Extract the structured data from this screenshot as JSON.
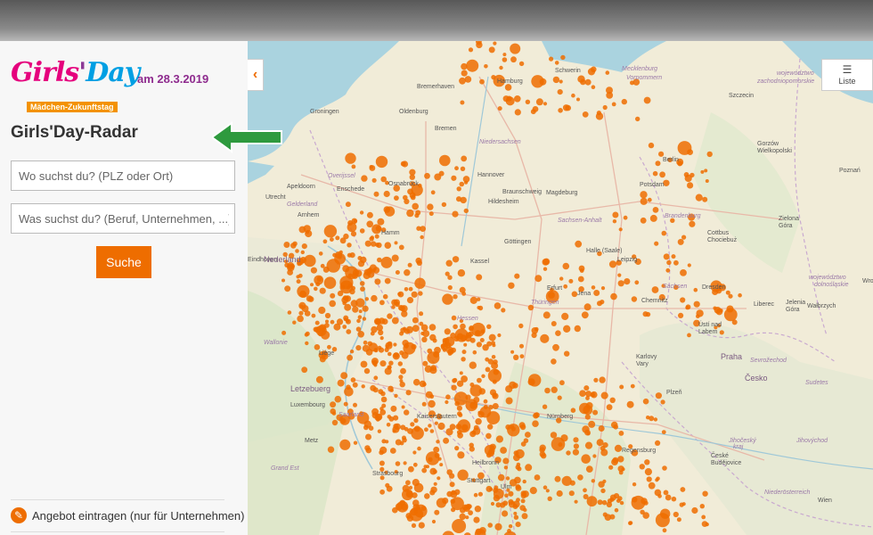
{
  "logo": {
    "part1": "Girls",
    "part2": "'",
    "part3": "Day",
    "banner": "Mädchen-Zukunftstag"
  },
  "date_label": "am 28.3.2019",
  "page_title": "Girls'Day-Radar",
  "search": {
    "where_placeholder": "Wo suchst du? (PLZ oder Ort)",
    "what_placeholder": "Was suchst du? (Beruf, Unternehmen, ...)",
    "button_label": "Suche"
  },
  "footer": {
    "offer_label": "Angebot eintragen (nur für Unternehmen)"
  },
  "map": {
    "collapse_icon": "‹",
    "list_label": "Liste",
    "list_icon": "☰",
    "marker_color": "#ee6d00",
    "labels": [
      {
        "t": "Hamburg"
      },
      {
        "t": "Schwerin"
      },
      {
        "t": "Mecklenburg"
      },
      {
        "t": "Vorpommern"
      },
      {
        "t": "województwo"
      },
      {
        "t": "zachodniopomorskie"
      },
      {
        "t": "Szczecin"
      },
      {
        "t": "Bremerhaven"
      },
      {
        "t": "Groningen"
      },
      {
        "t": "Oldenburg"
      },
      {
        "t": "Bremen"
      },
      {
        "t": "Niedersachsen"
      },
      {
        "t": "Hannover"
      },
      {
        "t": "Braunschweig"
      },
      {
        "t": "Magdeburg"
      },
      {
        "t": "Berlin"
      },
      {
        "t": "Potsdam"
      },
      {
        "t": "Brandenburg"
      },
      {
        "t": "Gorzów"
      },
      {
        "t": "Wielkopolski"
      },
      {
        "t": "Poznań"
      },
      {
        "t": "Zielona"
      },
      {
        "t": "Góra"
      },
      {
        "t": "Osnabrück"
      },
      {
        "t": "Enschede"
      },
      {
        "t": "Apeldoorn"
      },
      {
        "t": "Arnhem"
      },
      {
        "t": "Gelderland"
      },
      {
        "t": "Utrecht"
      },
      {
        "t": "Overijssel"
      },
      {
        "t": "Hildesheim"
      },
      {
        "t": "Sachsen-Anhalt"
      },
      {
        "t": "Göttingen"
      },
      {
        "t": "Kassel"
      },
      {
        "t": "Halle (Saale)"
      },
      {
        "t": "Leipzig"
      },
      {
        "t": "Cottbus"
      },
      {
        "t": "Chociebuż"
      },
      {
        "t": "Dresden"
      },
      {
        "t": "Sachsen"
      },
      {
        "t": "Erfurt"
      },
      {
        "t": "Jena"
      },
      {
        "t": "Thüringen"
      },
      {
        "t": "Chemnitz"
      },
      {
        "t": "Eindhoven"
      },
      {
        "t": "Hamm"
      },
      {
        "t": "Hessen"
      },
      {
        "t": "Liberec"
      },
      {
        "t": "Jelenia"
      },
      {
        "t": "Góra"
      },
      {
        "t": "Wałbrzych"
      },
      {
        "t": "Ústí nad"
      },
      {
        "t": "Labem"
      },
      {
        "t": "Karlovy"
      },
      {
        "t": "Vary"
      },
      {
        "t": "Praha"
      },
      {
        "t": "Česko"
      },
      {
        "t": "Plzeň"
      },
      {
        "t": "Letzebuerg"
      },
      {
        "t": "Luxembourg"
      },
      {
        "t": "Saarland"
      },
      {
        "t": "Nürnberg"
      },
      {
        "t": "Regensburg"
      },
      {
        "t": "Metz"
      },
      {
        "t": "Strasbourg"
      },
      {
        "t": "Grand Est"
      },
      {
        "t": "České"
      },
      {
        "t": "Budějovice"
      },
      {
        "t": "Jihočeský"
      },
      {
        "t": "kraj"
      },
      {
        "t": "Niederösterreich"
      },
      {
        "t": "Wien"
      },
      {
        "t": "Wallonie"
      },
      {
        "t": "Nederland"
      },
      {
        "t": "Liège"
      },
      {
        "t": "Kaiserslautern"
      },
      {
        "t": "Heilbronn"
      },
      {
        "t": "Stuttgart"
      },
      {
        "t": "Ulm"
      },
      {
        "t": "Sevrožechod"
      },
      {
        "t": "Jihovýchod"
      },
      {
        "t": "województwo"
      },
      {
        "t": "dolnośląskie"
      },
      {
        "t": "Wrocław"
      },
      {
        "t": "Sudetes"
      }
    ]
  }
}
